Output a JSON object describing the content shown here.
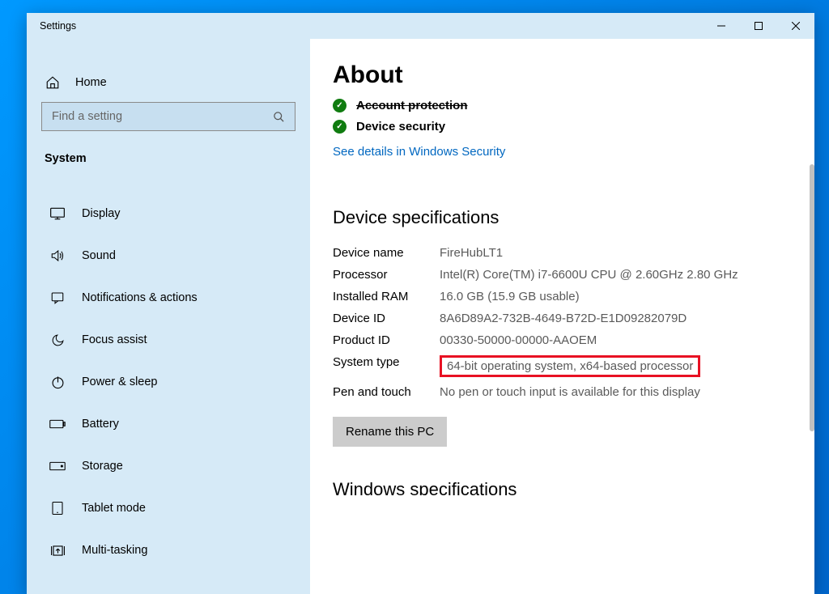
{
  "window": {
    "title": "Settings"
  },
  "sidebar": {
    "home_label": "Home",
    "search_placeholder": "Find a setting",
    "heading": "System",
    "items": [
      {
        "label": "Display",
        "icon": "display-icon"
      },
      {
        "label": "Sound",
        "icon": "sound-icon"
      },
      {
        "label": "Notifications & actions",
        "icon": "notifications-icon"
      },
      {
        "label": "Focus assist",
        "icon": "moon-icon"
      },
      {
        "label": "Power & sleep",
        "icon": "power-icon"
      },
      {
        "label": "Battery",
        "icon": "battery-icon"
      },
      {
        "label": "Storage",
        "icon": "storage-icon"
      },
      {
        "label": "Tablet mode",
        "icon": "tablet-icon"
      },
      {
        "label": "Multi-tasking",
        "icon": "multitask-icon"
      }
    ]
  },
  "content": {
    "page_title": "About",
    "security_cut_label": "Account protection",
    "device_security_label": "Device security",
    "see_details_link": "See details in Windows Security",
    "device_specs_title": "Device specifications",
    "specs": {
      "device_name_label": "Device name",
      "device_name_value": "FireHubLT1",
      "processor_label": "Processor",
      "processor_value": "Intel(R) Core(TM) i7-6600U CPU @ 2.60GHz   2.80 GHz",
      "ram_label": "Installed RAM",
      "ram_value": "16.0 GB (15.9 GB usable)",
      "device_id_label": "Device ID",
      "device_id_value": "8A6D89A2-732B-4649-B72D-E1D09282079D",
      "product_id_label": "Product ID",
      "product_id_value": "00330-50000-00000-AAOEM",
      "system_type_label": "System type",
      "system_type_value": "64-bit operating system, x64-based processor",
      "pen_touch_label": "Pen and touch",
      "pen_touch_value": "No pen or touch input is available for this display"
    },
    "rename_button": "Rename this PC",
    "windows_specs_title": "Windows specifications"
  }
}
